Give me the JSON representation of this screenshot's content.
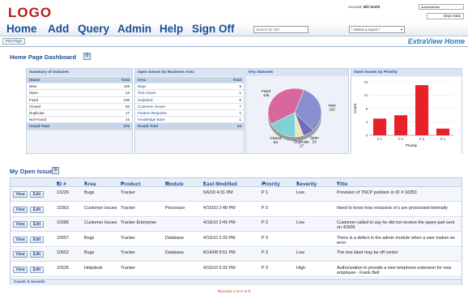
{
  "app": {
    "logo": "LOGO"
  },
  "account": {
    "label": "Account:",
    "name": "Bill Smith",
    "role": "Administrator",
    "mode": "Days Data"
  },
  "nav": {
    "items": [
      "Home",
      "Add",
      "Query",
      "Admin",
      "Help",
      "Sign Off"
    ],
    "search_placeholder": "Search for ID#",
    "report_select": "* Select a report *"
  },
  "toolbar": {
    "print": "Print Page",
    "brand": "ExtraView Home"
  },
  "dashboard": {
    "title": "Home Page Dashboard",
    "summary": {
      "title": "Summary of Statuses",
      "head": [
        "Status",
        "Total"
      ],
      "rows": [
        [
          "New",
          "115"
        ],
        [
          "Open",
          "24"
        ],
        [
          "Fixed",
          "136"
        ],
        [
          "Closed",
          "63"
        ],
        [
          "Duplicate",
          "17"
        ],
        [
          "Not Found",
          "15"
        ]
      ],
      "total": [
        "Grand Total",
        "375"
      ]
    },
    "open_by_area": {
      "title": "Open Issues by Business Area",
      "head": [
        "Area",
        "Total"
      ],
      "rows": [
        [
          "Bugs",
          "9"
        ],
        [
          "Test Cases",
          "1"
        ],
        [
          "Helpdesk",
          "5"
        ],
        [
          "Customer Issues",
          "7"
        ],
        [
          "Feature Requests",
          "1"
        ],
        [
          "Knowledge Base",
          "1"
        ]
      ],
      "total": [
        "Grand Total",
        "24"
      ]
    },
    "key_statuses": {
      "title": "Key Statuses"
    },
    "priority": {
      "title": "Open Issues by Priority"
    }
  },
  "chart_data": [
    {
      "type": "pie",
      "title": "Key Statuses",
      "slices": [
        {
          "label": "New",
          "value": 115,
          "color": "#8a8fd1"
        },
        {
          "label": "Open",
          "value": 24,
          "color": "#6b6fb8"
        },
        {
          "label": "Duplicate",
          "value": 17,
          "color": "#e7e9b8"
        },
        {
          "label": "Closed",
          "value": 63,
          "color": "#7fd1d8"
        },
        {
          "label": "Fixed",
          "value": 136,
          "color": "#d6689b"
        }
      ]
    },
    {
      "type": "bar",
      "title": "Open Issues by Priority",
      "categories": [
        "P 1",
        "P 2",
        "P 3",
        "P 4"
      ],
      "values": [
        5,
        6,
        15,
        2
      ],
      "ylim": [
        0,
        16
      ],
      "yticks": [
        0,
        4,
        8,
        12,
        16
      ],
      "ylabel": "Count",
      "xlabel": "Priority",
      "color": "#e8202a"
    }
  ],
  "myissues": {
    "title": "My Open Issues",
    "columns": [
      "ID #",
      "Area",
      "Product",
      "Module",
      "Last Modified",
      "Priority",
      "Severity",
      "Title"
    ],
    "view": "View",
    "edit": "Edit",
    "rows": [
      [
        "10226",
        "Bugs",
        "Tracker",
        "",
        "5/6/10 4:31 PM",
        "P 1",
        "Low",
        "Provision of TNCP problem in ID # 10353"
      ],
      [
        "10363",
        "Customer Issues",
        "Tracker",
        "Processor",
        "4/15/10 2:48 PM",
        "P 2",
        "",
        "Need to know how exclusive or's are processed internally"
      ],
      [
        "10285",
        "Customer Issues",
        "Tracker Enterprise",
        "",
        "4/15/10 2:45 PM",
        "P 2",
        "Low",
        "Customer called to say he did not receive the spare part sent on 4/3/05"
      ],
      [
        "10557",
        "Bugs",
        "Tracker",
        "Database",
        "4/15/10 2:33 PM",
        "P 3",
        "",
        "There is a defect in the admin module when a user makes an error"
      ],
      [
        "10552",
        "Bugs",
        "Tracker",
        "Database",
        "8/14/08 9:51 PM",
        "P 3",
        "Low",
        "The box label may be off center"
      ],
      [
        "10526",
        "Helpdesk",
        "Tracker",
        "",
        "4/15/10 6:33 PM",
        "P 3",
        "High",
        "Authorization to provide a new telephone extension for new employee - Frank Bell"
      ]
    ],
    "count": "Count: 6 records"
  },
  "footer": {
    "records": "Records 1 to 6 of 6"
  }
}
